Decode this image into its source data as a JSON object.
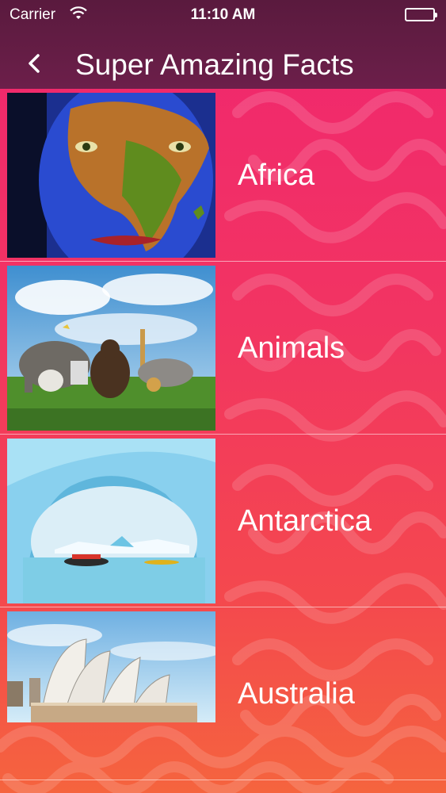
{
  "status_bar": {
    "carrier": "Carrier",
    "time": "11:10 AM"
  },
  "header": {
    "title": "Super Amazing Facts",
    "back_icon": "chevron-left-icon"
  },
  "list": {
    "items": [
      {
        "label": "Africa",
        "image": "africa-face-paint-image"
      },
      {
        "label": "Animals",
        "image": "animals-group-image"
      },
      {
        "label": "Antarctica",
        "image": "antarctica-ice-arch-image"
      },
      {
        "label": "Australia",
        "image": "sydney-opera-house-image"
      }
    ]
  },
  "colors": {
    "header_bg": "#6c1f4a",
    "gradient_top": "#f0266f",
    "gradient_bottom": "#f5643e",
    "text": "#ffffff"
  }
}
